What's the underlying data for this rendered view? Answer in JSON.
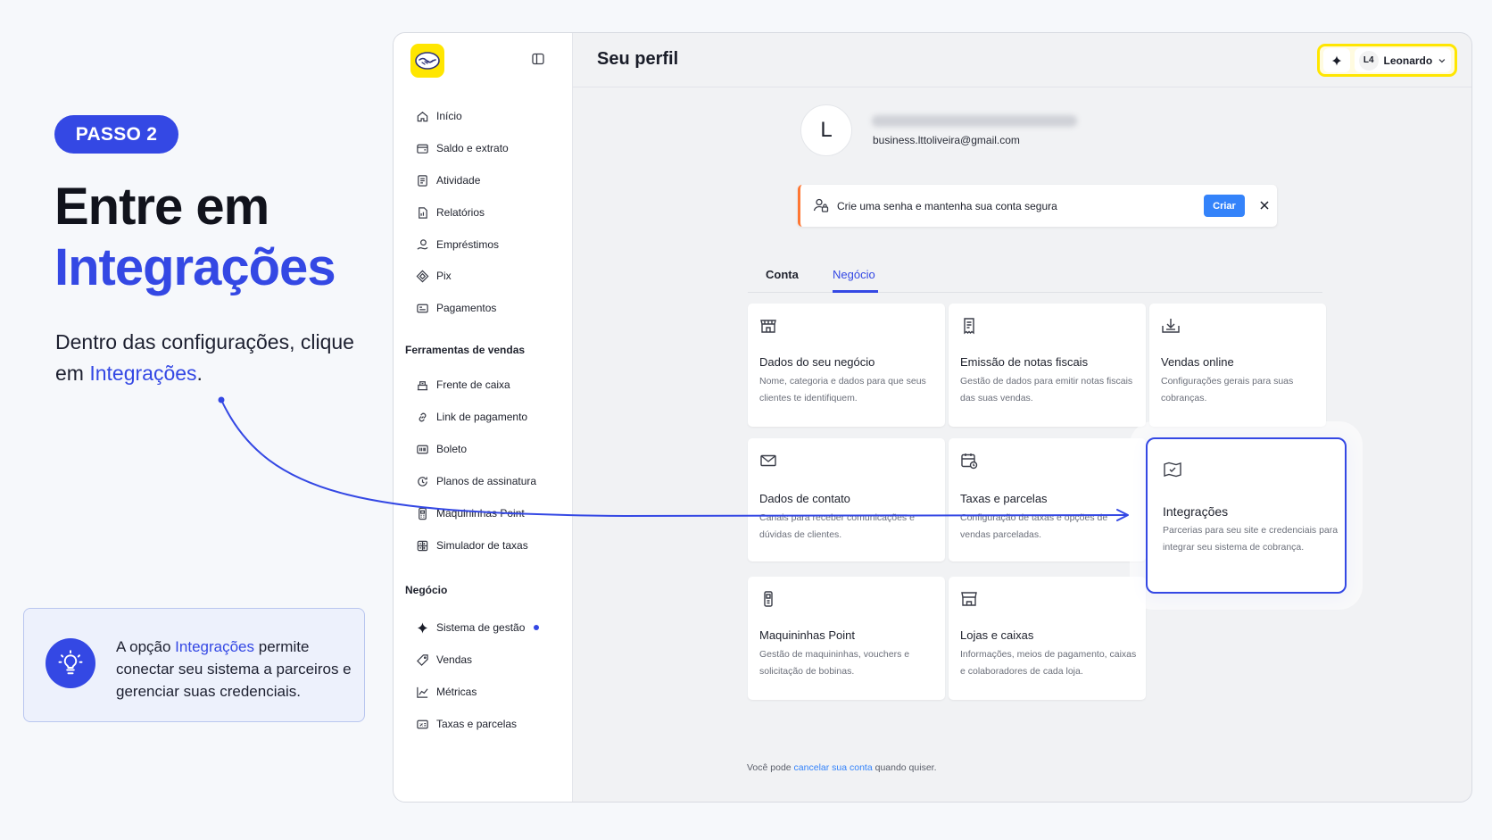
{
  "tutorial": {
    "step_badge": "PASSO 2",
    "headline_line1": "Entre em",
    "headline_line2": "Integrações",
    "instruction_prefix": "Dentro das configurações, clique em ",
    "instruction_highlight": "Integrações",
    "instruction_suffix": ".",
    "tip_prefix": "A opção ",
    "tip_highlight": "Integrações",
    "tip_suffix": " permite conectar seu sistema a parceiros e gerenciar suas credenciais.",
    "accent_color": "#3448e4"
  },
  "app": {
    "page_title": "Seu perfil",
    "user": {
      "initials": "L4",
      "name": "Leonardo"
    },
    "sidebar": {
      "main_items": [
        {
          "label": "Início",
          "icon": "home-icon"
        },
        {
          "label": "Saldo e extrato",
          "icon": "wallet-icon"
        },
        {
          "label": "Atividade",
          "icon": "activity-icon"
        },
        {
          "label": "Relatórios",
          "icon": "reports-icon"
        },
        {
          "label": "Empréstimos",
          "icon": "loans-icon"
        },
        {
          "label": "Pix",
          "icon": "pix-icon"
        },
        {
          "label": "Pagamentos",
          "icon": "payments-icon"
        }
      ],
      "sales_tools_title": "Ferramentas de vendas",
      "sales_tools": [
        {
          "label": "Frente de caixa",
          "icon": "register-icon"
        },
        {
          "label": "Link de pagamento",
          "icon": "link-icon"
        },
        {
          "label": "Boleto",
          "icon": "boleto-icon"
        },
        {
          "label": "Planos de assinatura",
          "icon": "subscription-icon"
        },
        {
          "label": "Maquininhas Point",
          "icon": "pos-icon"
        },
        {
          "label": "Simulador de taxas",
          "icon": "calculator-icon"
        }
      ],
      "business_title": "Negócio",
      "business_items": [
        {
          "label": "Sistema de gestão",
          "icon": "sparkle-icon"
        },
        {
          "label": "Vendas",
          "icon": "tag-icon"
        },
        {
          "label": "Métricas",
          "icon": "chart-icon"
        },
        {
          "label": "Taxas e parcelas",
          "icon": "fees-icon"
        }
      ]
    },
    "profile": {
      "avatar_letter": "L",
      "email": "business.lttoliveira@gmail.com"
    },
    "alert": {
      "text": "Crie uma senha e mantenha sua conta segura",
      "button": "Criar"
    },
    "tabs": {
      "account": "Conta",
      "business": "Negócio",
      "active": "Negócio"
    },
    "cards": [
      {
        "title": "Dados do seu negócio",
        "desc": "Nome, categoria e dados para que seus clientes te identifiquem.",
        "icon": "store-icon"
      },
      {
        "title": "Emissão de notas fiscais",
        "desc": "Gestão de dados para emitir notas fiscais das suas vendas.",
        "icon": "receipt-icon"
      },
      {
        "title": "Vendas online",
        "desc": "Configurações gerais para suas cobranças.",
        "icon": "download-tray-icon"
      },
      {
        "title": "Dados de contato",
        "desc": "Canais para receber comunicações e dúvidas de clientes.",
        "icon": "mail-icon"
      },
      {
        "title": "Taxas e parcelas",
        "desc": "Configuração de taxas e opções de vendas parceladas.",
        "icon": "calendar-icon"
      },
      {
        "title": "Integrações",
        "desc": "Parcerias para seu site e credenciais para integrar seu sistema de cobrança.",
        "icon": "integration-icon"
      },
      {
        "title": "Maquininhas Point",
        "desc": "Gestão de maquininhas, vouchers e solicitação de bobinas.",
        "icon": "pos-device-icon"
      },
      {
        "title": "Lojas e caixas",
        "desc": "Informações, meios de pagamento, caixas e colaboradores de cada loja.",
        "icon": "shop-icon"
      }
    ],
    "footer": {
      "prefix": "Você pode ",
      "link": "cancelar sua conta",
      "suffix": " quando quiser."
    },
    "colors": {
      "brand_yellow": "#ffe600",
      "link_blue": "#3483fa",
      "alert_orange": "#ff7733"
    }
  }
}
